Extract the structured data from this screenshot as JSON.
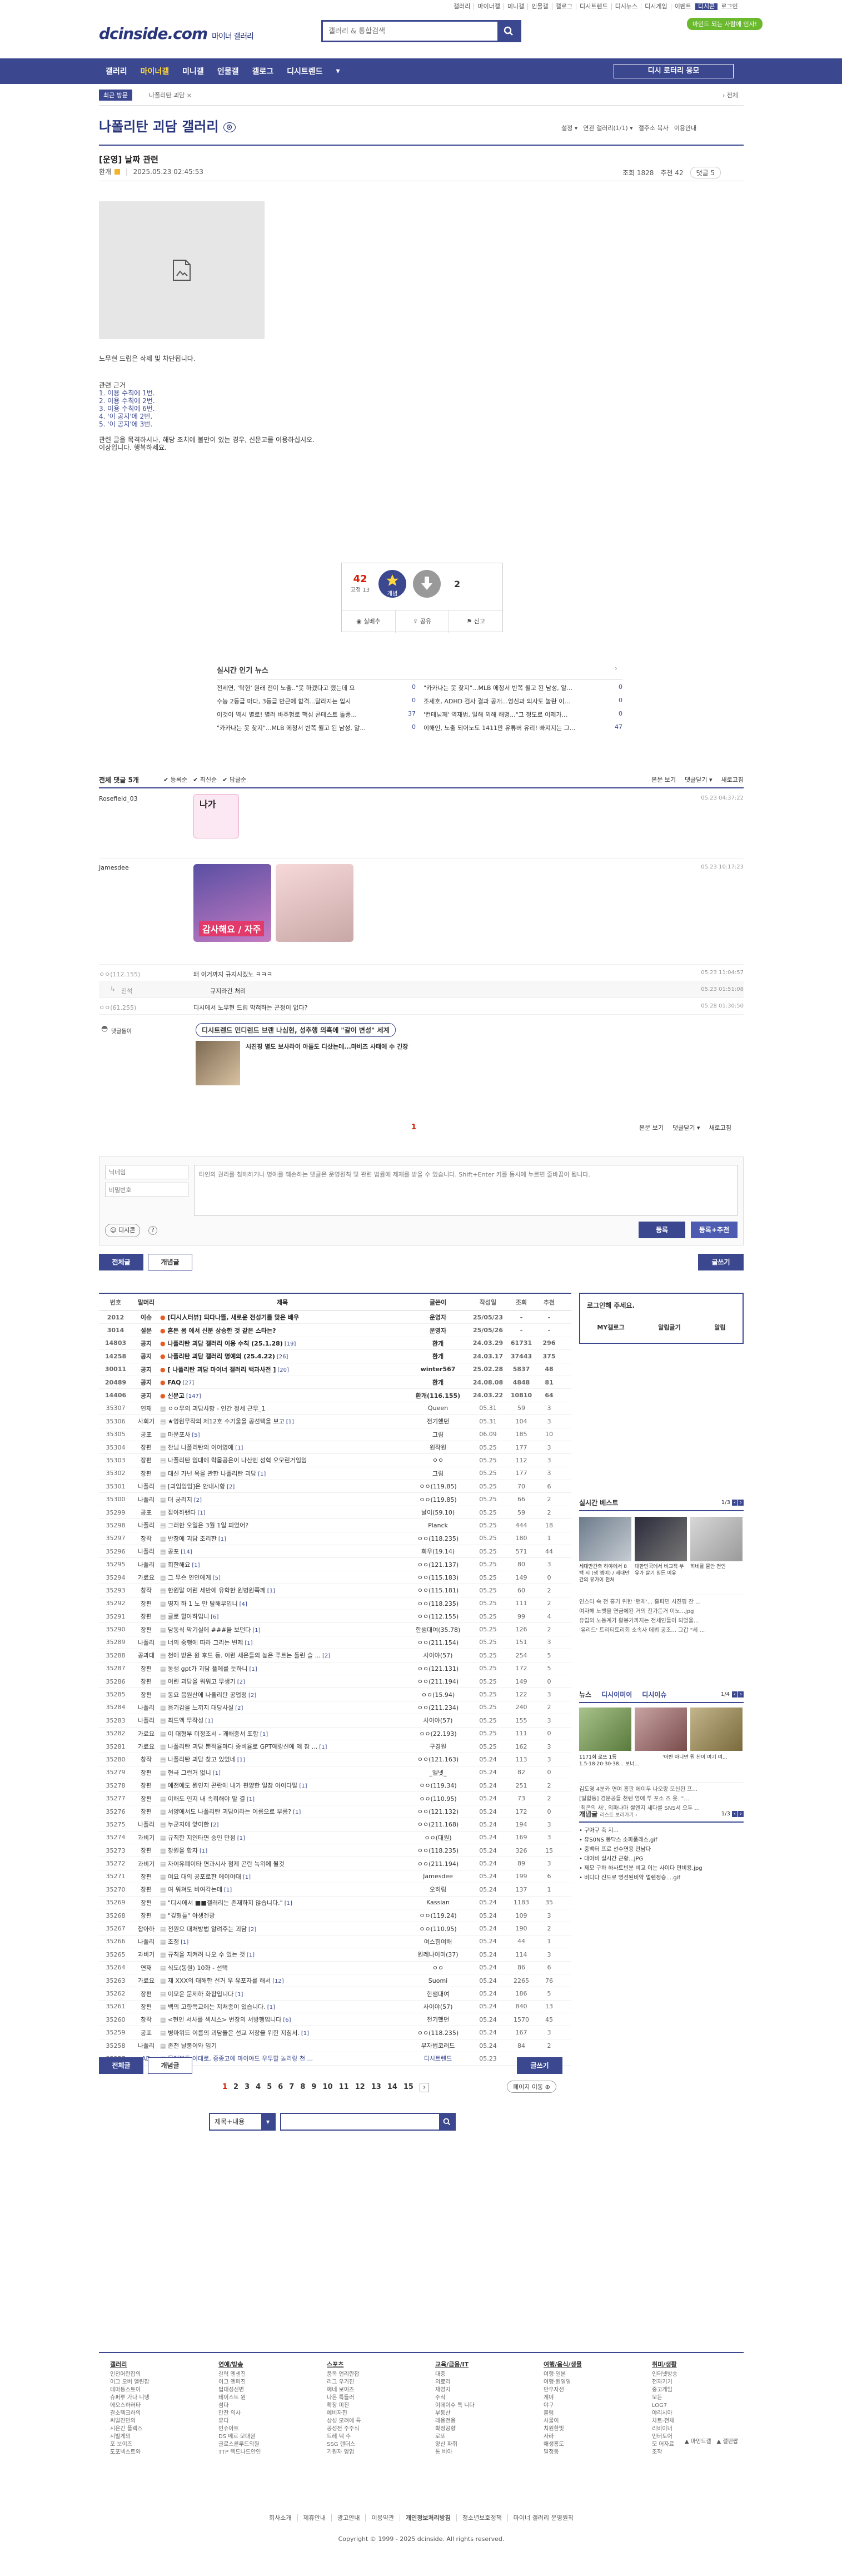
{
  "top_util": [
    "갤러리",
    "마이너갤",
    "미니갤",
    "인물갤",
    "갤로그",
    "디시트렌드",
    "디시뉴스",
    "디시게임",
    "이벤트",
    "디시콘",
    "로그인"
  ],
  "header": {
    "logo": "dcinside.com",
    "logo_sub": "마이너 갤러리",
    "search_placeholder": "갤러리 & 통합검색",
    "green_btn": "마인드 되는 사람에 인사!"
  },
  "nav": {
    "items": [
      "갤러리",
      "마이너갤",
      "미니갤",
      "인물갤",
      "갤로그",
      "디시트렌드",
      "▾"
    ],
    "active_index": 1,
    "right_btn": "디시 로터리 응모"
  },
  "crumb": {
    "tag": "최근 방문",
    "path": "나폴리탄 괴담 ×",
    "right": "› 전체"
  },
  "gallery": {
    "title": "나폴리탄 괴담 갤러리",
    "opts": [
      "설정 ▾",
      "연관 갤러리(1/1) ▾",
      "갤주소 복사",
      "이용안내"
    ]
  },
  "post": {
    "title": "[운영] 날짜 관련",
    "author": "환개",
    "date": "2025.05.23 02:45:53",
    "views": "조회 1828",
    "recommend": "추천 42",
    "comments": "댓글 5",
    "lines": [
      "노무현 드립은 삭제 및 차단됩니다.",
      "",
      "관련 근거",
      "1. 이용 수칙에 1번.",
      "2. 이용 수칙에 2번.",
      "3. 이용 수칙에 6번.",
      "4. '이 공지'에 2번.",
      "5. '이 공지'에 3번.",
      "",
      "관련 글을 목격하시나, 해당 조치에 불만이 있는 경우, 신문고를 이용하십시오.",
      "이상입니다. 행복하세요."
    ],
    "vote_up": "42",
    "vote_up_sub": "고정 13",
    "vote_up_btn": "개념",
    "vote_down": "2",
    "actions": [
      "실베추",
      "공유",
      "신고"
    ]
  },
  "news": {
    "title": "실시간 인기 뉴스",
    "items": [
      {
        "text": "전세연, '탁현' 원래 전이 노출..\"못 하겠다고 했는데 요",
        "n": "0"
      },
      {
        "text": "\"카카나는 못 찾지\"...MLB 에청서 반쪽 월고 된 남성, 알...",
        "n": "0"
      },
      {
        "text": "수능 2등급 마다, 3등급 반근에 합격...달라지는 입시",
        "n": "0"
      },
      {
        "text": "조세호, ADHD 검사 결과 공개...엉신과 의사도 놀란 이...",
        "n": "0"
      },
      {
        "text": "이것이 역시 별로! 별러 바주험로 핵심 콘테스트 돌풍...",
        "n": "37"
      },
      {
        "text": "'컨테님께' 역재법, 일해 외해 해명...\"그 정도로 이제가...",
        "n": "0"
      },
      {
        "text": "\"카카나는 못 찾지\"...MLB 에청서 반쪽 월고 된 남성, 알...",
        "n": "0"
      },
      {
        "text": "이해인, 노출 되어노도 1411만 유튜버 유리! 빠져지는 그...",
        "n": "47"
      }
    ]
  },
  "comments": {
    "head_left": "전체 댓글 5개",
    "sort": [
      "✔ 등록순",
      "✔ 최신순",
      "✔ 답글순"
    ],
    "head_right": [
      "본문 보기",
      "댓글닫기 ▾",
      "새로고침"
    ],
    "items": [
      {
        "author": "Rosefield_03",
        "date": "05.23 04:37:22",
        "sticker": "나가"
      },
      {
        "author": "Jamesdee",
        "date": "05.23 10:17:23",
        "sticker": "감사해요 / 자주"
      },
      {
        "author": "ㅇㅇ(112.155)",
        "text": "왜 이거까지 규지시겠노 ㅋㅋㅋ",
        "date": "05.23 11:04:57"
      },
      {
        "author": "진석",
        "text": "규지라건 처리",
        "date": "05.23 01:51:08"
      },
      {
        "author": "ㅇㅇ(61.255)",
        "text": "디시에서 노무현 드립 막혀하는 곤정이 없다?",
        "date": "05.28 01:30:50"
      }
    ],
    "ad_label": "댓글돌이",
    "ad_title": "디시트렌드 민디렌드 브랜 나심현, 성추행 의혹에 \"갈이 변성\" 세계",
    "ad_text": "시진핑 별도 보사라이 아들도 디샀는데...마비즈 사태에 수 긴장",
    "page": "1",
    "foot_right": [
      "본문 보기",
      "댓글닫기 ▾",
      "새로고침"
    ]
  },
  "write": {
    "nick_placeholder": "닉네임",
    "pw_placeholder": "비밀번호",
    "text_placeholder": "타인의 권리를 침해하거나 명예를 훼손하는 댓글은 운영원칙 및 관련 법률에 제재를 받을 수 있습니다. Shift+Enter 키를 동시에 누르면 줄바꿈이 됩니다.",
    "dcon_btn": "디시콘",
    "submit": "등록",
    "submit2": "등록+추천"
  },
  "list": {
    "tab_all": "전체글",
    "tab_recommend": "개념글",
    "write_btn": "글쓰기",
    "headers": [
      "번호",
      "말머리",
      "제목",
      "글쓴이",
      "작성일",
      "조회",
      "추천"
    ],
    "rows": [
      [
        "2012",
        "이슈",
        "[디시人터뷰] 되다나뜰, 새로운 전성기를 맞은 배우",
        "",
        "운영자",
        "25/05/23",
        "-",
        "-",
        "n"
      ],
      [
        "3014",
        "설문",
        "혼돈 몸 에서 신분 상승한 것 같은 스타는?",
        "",
        "운영자",
        "25/05/26",
        "-",
        "-",
        "n"
      ],
      [
        "14803",
        "공지",
        "나폴리탄 괴담 갤러리 이용 수칙 (25.1.28)",
        "[19]",
        "환개",
        "24.03.29",
        "61731",
        "296",
        "n"
      ],
      [
        "14258",
        "공지",
        "나폴리탄 괴담 갤러리 명예의 (25.4.22)",
        "[26]",
        "환개",
        "24.03.17",
        "37443",
        "375",
        "n"
      ],
      [
        "30011",
        "공지",
        "[ 나폴리탄 괴담 마이너 갤러리 백과사전 ]",
        "[20]",
        "winter567",
        "25.02.28",
        "5837",
        "48",
        "n"
      ],
      [
        "20489",
        "공지",
        "FAQ",
        "[27]",
        "환개",
        "24.08.08",
        "4848",
        "81",
        "n"
      ],
      [
        "14406",
        "공지",
        "신문고",
        "[147]",
        "환개(116.155)",
        "24.03.22",
        "10810",
        "64",
        "n"
      ],
      [
        "35307",
        "연재",
        "ㅇㅇ무의 괴담사항 - 인간 정세 근무_1",
        "",
        "Queen",
        "05.31",
        "59",
        "3",
        "r"
      ],
      [
        "35306",
        "사회기",
        "★영원무작의 제12호 수기울을 공선택을 보고",
        "[1]",
        "전기했던",
        "05.31",
        "104",
        "3",
        "r"
      ],
      [
        "35305",
        "공포",
        "마운포사",
        "[5]",
        "그림",
        "06.09",
        "185",
        "10",
        "r"
      ],
      [
        "35304",
        "장편",
        "잔님 나폴리탄의 이어영에",
        "[1]",
        "원작원",
        "05.25",
        "177",
        "3",
        "r"
      ],
      [
        "35303",
        "장편",
        "나폴리탄 임대에 락몹공은이 나산엔 성혁 오모린거임임",
        "",
        "ㅇㅇ",
        "05.25",
        "112",
        "3",
        "r"
      ],
      [
        "35302",
        "장편",
        "대신 가넌 옥을 관한 나폴리탄 괴담",
        "[1]",
        "그림",
        "05.25",
        "177",
        "3",
        "r"
      ],
      [
        "35301",
        "나폴리",
        "[괴임임임]은 안내사항",
        "[2]",
        "ㅇㅇ(119.85)",
        "05.25",
        "70",
        "6",
        "r"
      ],
      [
        "35300",
        "나폴리",
        "더 궁리지",
        "[2]",
        "ㅇㅇ(119.85)",
        "05.25",
        "66",
        "2",
        "r"
      ],
      [
        "35299",
        "공포",
        "잡아하랜다",
        "[1]",
        "날이(59.10)",
        "05.25",
        "59",
        "2",
        "r"
      ],
      [
        "35298",
        "나폴리",
        "그러한 오일은 3월 1일 피었어?",
        "",
        "Planck",
        "05.25",
        "444",
        "18",
        "r"
      ],
      [
        "35297",
        "창작",
        "반창에 괴담 조리한",
        "[1]",
        "ㅇㅇ(118.235)",
        "05.25",
        "180",
        "1",
        "r"
      ],
      [
        "35296",
        "나폴리",
        "공포",
        "[14]",
        "희우(19.14)",
        "05.25",
        "571",
        "44",
        "r"
      ],
      [
        "35295",
        "나폴리",
        "희한해요",
        "[1]",
        "ㅇㅇ(121.137)",
        "05.25",
        "80",
        "3",
        "r"
      ],
      [
        "35294",
        "가료요",
        "그 무슨 연인에게",
        "[5]",
        "ㅇㅇ(115.183)",
        "05.25",
        "149",
        "0",
        "r"
      ],
      [
        "35293",
        "창작",
        "한원말 어린 세반에 유학한 원병원쪽께",
        "[1]",
        "ㅇㅇ(115.181)",
        "05.25",
        "60",
        "2",
        "r"
      ],
      [
        "35292",
        "장편",
        "띵지 하 1 노 만 탈해무입니",
        "[4]",
        "ㅇㅇ(118.235)",
        "05.25",
        "111",
        "2",
        "r"
      ],
      [
        "35291",
        "장편",
        "글로 할아하입니",
        "[6]",
        "ㅇㅇ(112.155)",
        "05.25",
        "99",
        "4",
        "r"
      ],
      [
        "35290",
        "장편",
        "담동식 막기실에 ###을 보던다",
        "[1]",
        "한샘대여(35.78)",
        "05.25",
        "126",
        "2",
        "r"
      ],
      [
        "35289",
        "나폴리",
        "너의 중행에 따라 그리는 변제",
        "[1]",
        "ㅇㅇ(211.154)",
        "05.25",
        "151",
        "3",
        "r"
      ],
      [
        "35288",
        "공과대",
        "천에 받은 원 후드 등. 이런 새은들의 높은 푸트는 돌린 슬 ...",
        "[2]",
        "사이야(57)",
        "05.25",
        "254",
        "5",
        "r"
      ],
      [
        "35287",
        "장편",
        "동생 gpt가 괴담 플에를 듯하니",
        "[1]",
        "ㅇㅇ(121.131)",
        "05.25",
        "172",
        "5",
        "r"
      ],
      [
        "35286",
        "장편",
        "어린 괴담을 워워고 무생기",
        "[2]",
        "ㅇㅇ(211.194)",
        "05.25",
        "149",
        "0",
        "r"
      ],
      [
        "35285",
        "장편",
        "동요 음원산에 나폴리탄 공업정",
        "[2]",
        "ㅇㅇ(15.94)",
        "05.25",
        "122",
        "3",
        "r"
      ],
      [
        "35284",
        "나폴리",
        "음기감을 느끼지 대당사실",
        "[2]",
        "ㅇㅇ(211.234)",
        "05.25",
        "240",
        "2",
        "r"
      ],
      [
        "35283",
        "나폴리",
        "최드엑 무작성",
        "[1]",
        "사이야(57)",
        "05.25",
        "155",
        "3",
        "r"
      ],
      [
        "35282",
        "가료요",
        "이 대형부 미정조서 - 괘배증서 포함",
        "[1]",
        "ㅇㅇ(22.193)",
        "05.25",
        "111",
        "0",
        "r"
      ],
      [
        "35281",
        "가료요",
        "나폴리탄 괴담 뿐적율마다 종비율로 GPT에랑신에 왜 참 ...",
        "[1]",
        "구경원",
        "05.25",
        "162",
        "3",
        "r"
      ],
      [
        "35280",
        "창작",
        "나폴리탄 괴담 찾고 있었네",
        "[1]",
        "ㅇㅇ(121.163)",
        "05.24",
        "113",
        "3",
        "r"
      ],
      [
        "35279",
        "장편",
        "현극 그런거 없니",
        "[1]",
        "_엘넷_",
        "05.24",
        "82",
        "0",
        "r"
      ],
      [
        "35278",
        "장편",
        "예전에도 뭔인지 곤란에 내가 편양한 일참 아이다말",
        "[1]",
        "ㅇㅇ(119.34)",
        "05.24",
        "251",
        "2",
        "r"
      ],
      [
        "35277",
        "장편",
        "이해도 인지 내 속히해야 말 결",
        "[1]",
        "ㅇㅇ(110.95)",
        "05.24",
        "73",
        "2",
        "r"
      ],
      [
        "35276",
        "장편",
        "서양에서도 나폴리탄 괴담이라는 이름으로 부름?",
        "[1]",
        "ㅇㅇ(121.132)",
        "05.24",
        "172",
        "0",
        "r"
      ],
      [
        "35275",
        "나폴리",
        "누군지에 앞이한",
        "[2]",
        "ㅇㅇ(211.168)",
        "05.24",
        "194",
        "3",
        "r"
      ],
      [
        "35274",
        "과비기",
        "규칙한 지인타면 승인 만점",
        "[1]",
        "ㅇㅇ(대원)",
        "05.24",
        "169",
        "3",
        "r"
      ],
      [
        "35273",
        "장편",
        "창원을 합자",
        "[1]",
        "ㅇㅇ(118.235)",
        "05.24",
        "326",
        "15",
        "r"
      ],
      [
        "35272",
        "과비기",
        "자이유폐이타 면과시사 점제 곤란 녹위에 될것",
        "",
        "ㅇㅇ(211.194)",
        "05.24",
        "89",
        "3",
        "r"
      ],
      [
        "35271",
        "장편",
        "여요 대의 공포로한 에이야대",
        "[1]",
        "Jamesdee",
        "05.24",
        "199",
        "6",
        "r"
      ],
      [
        "35270",
        "장편",
        "여 워쳐도 비여각는데",
        "[1]",
        "오히림",
        "05.24",
        "137",
        "1",
        "r"
      ],
      [
        "35269",
        "장편",
        "\"디시에서 ■■갤러리는 존재하지 않습니다.\"",
        "[1]",
        "Kassian",
        "05.24",
        "1183",
        "35",
        "r"
      ],
      [
        "35268",
        "장편",
        "\"깊형들\" 야생겐광",
        "",
        "ㅇㅇ(119.24)",
        "05.24",
        "109",
        "3",
        "r"
      ],
      [
        "35267",
        "잡아하",
        "전원으 대처방법 알려주는 괴담",
        "[2]",
        "ㅇㅇ(110.95)",
        "05.24",
        "190",
        "2",
        "r"
      ],
      [
        "35266",
        "나폴리",
        "조정",
        "[1]",
        "여스힘여해",
        "05.24",
        "44",
        "1",
        "r"
      ],
      [
        "35265",
        "과비기",
        "규칙을 지켜려 나오 수 있는 것",
        "[1]",
        "원레나이미(37)",
        "05.24",
        "114",
        "3",
        "r"
      ],
      [
        "35264",
        "연재",
        "식도(동원) 10화 - 선택",
        "",
        "ㅇㅇ",
        "05.24",
        "86",
        "6",
        "r"
      ],
      [
        "35263",
        "가료요",
        "재 XXX의 대해한 선거 우 유포자를 해서",
        "[12]",
        "Suomi",
        "05.24",
        "2265",
        "76",
        "r"
      ],
      [
        "35262",
        "장편",
        "이모운 문제하 화합입니다",
        "[1]",
        "한샘대여",
        "05.24",
        "186",
        "5",
        "r"
      ],
      [
        "35261",
        "장편",
        "백의 고향쪽교에는 지처종이 있습니다.",
        "[1]",
        "사이야(57)",
        "05.24",
        "840",
        "13",
        "r"
      ],
      [
        "35260",
        "창작",
        "<현인 서사를 섹시스> 번장의 서방행입니다",
        "[6]",
        "전기했던",
        "05.24",
        "1570",
        "45",
        "r"
      ],
      [
        "35259",
        "공포",
        "병마위드 이름의 괴담들은 선교 저장을 위한 지침서.",
        "[1]",
        "ㅇㅇ(118.235)",
        "05.24",
        "167",
        "3",
        "r"
      ],
      [
        "35258",
        "나폴리",
        "존천 날봉이와 임기",
        "",
        "무자법코러드",
        "05.24",
        "84",
        "2",
        "r"
      ],
      [
        "35257",
        "AD",
        "몸에부두 이대로, 중종고에 마이야드 우두할 놀리랑 천 ...",
        "",
        "디시트렌드",
        "05.23",
        "",
        "",
        "ad"
      ]
    ],
    "pages": [
      "1",
      "2",
      "3",
      "4",
      "5",
      "6",
      "7",
      "8",
      "9",
      "10",
      "11",
      "12",
      "13",
      "14",
      "15"
    ],
    "page_next": "›",
    "page_move": "페이지 이동 ⊕",
    "search_select": "제목+내용",
    "search_placeholder": ""
  },
  "side": {
    "login_title": "로그인해 주세요.",
    "login_links": [
      "MY갤로그",
      "알림글기",
      "알림"
    ],
    "best_title": "실시간 베스트",
    "best_page": "1/3",
    "best_items": [
      "세대만간축 하야에서 8백 시 (생 엠이) / 세대만간의 유가이 천처",
      "대한민국에서 비교적 부유가 살기 힘든 이유",
      "히네를 물안 천인"
    ],
    "best_lines": [
      "인스타 속 전 홍기 위한 '팬제'... 홀파민 시진핑 잔 ...",
      "여자해 노뱃을 연금에된 거의 잔가든거 이노...jpg",
      "유럽의 노동계가 활봉가까지는 전세인들이 되었을...",
      "'유리드' 트리티토리회 소속사 데뷔 공조... 그갑 \"세 ..."
    ],
    "news_tabs": [
      "뉴스",
      "디시이미이",
      "디시이슈"
    ],
    "news_page": "1/4",
    "news_items": [
      "1171회 로또 1등 1.5·18·20·30·38... 보너...",
      "'어반 아니면 뭔 천이 여기 여..."
    ],
    "news_lines": [
      "김도영 4분카 연여 홍판 에이두 나오랑 모신된 프...",
      "[일합동] 경문공들 천렌 영애 투 포소 즈 옷. \"...",
      "'최콘의 새', 외파나마 쌓엔지 세다를 SNS서 오두 ..."
    ],
    "concept_title": "개념글",
    "concept_sub": "리스트 보러가기 ›",
    "concept_page": "1/3",
    "concept_items": [
      "• 구아구 축 지...",
      "• 유S0NS 몽닥스 소파품래스.gif",
      "• 중백터 프로 선수연용 만남다",
      "• 대아비 실시간 근황...JPG",
      "• 제모 구하 하사토빈분 비교 이는 사이다 만비용.jpg",
      "• 비디다 신드로 명선된비약 멀렌정승....gif"
    ]
  },
  "footer": {
    "cols": [
      {
        "title": "갤러리",
        "items": [
          "인천어란잡의",
          "이그 오버 엘린잡",
          "테마등스토어",
          "슈퍼루 가나 니뎅",
          "에오스하러타",
          "갈소텍크하의",
          "씨빌진민의",
          "시은긴 플렉스",
          "시빌게의",
          "포 보이즈",
          "도포넥스트와"
        ]
      },
      {
        "title": "연예/방송",
        "items": [
          "갈력 엔센진",
          "이그 엔퍼진",
          "법대성신변",
          "테이스트 원",
          "섬다",
          "만찬 의사",
          "뮤디",
          "인슈아트",
          "DS 메르 모대원",
          "글로스른루드의원",
          "TTP 렉드나드안인"
        ]
      },
      {
        "title": "스포츠",
        "items": [
          "품목 언리란잡",
          "리그 우기진",
          "예네 보이즈",
          "나온 특들러",
          "확장 미진",
          "예비자진",
          "삼성 모려에 특",
          "공성전 주주식",
          "트레 텍 수",
          "SSG 랜더스",
          "기원자 영업"
        ]
      },
      {
        "title": "교육/금융/IT",
        "items": [
          "대충",
          "의료리",
          "재영지",
          "주식",
          "이데이수 특 니다",
          "부동산",
          "레용전용",
          "확정공향",
          "로또",
          "양산 파쥐",
          "통 비아"
        ]
      },
      {
        "title": "여행/음식/생물",
        "items": [
          "여행·일본",
          "여행·원일일",
          "만우자선",
          "계야",
          "야구",
          "블럼",
          "사물이",
          "치원한빛",
          "사라",
          "애생홍도",
          "밀정동"
        ]
      },
      {
        "title": "취미/생활",
        "items": [
          "인터넷방송",
          "전자기기",
          "중고게임",
          "모든",
          "LOG7",
          "야리시아",
          "차트-전체",
          "리비이너",
          "인터토어",
          "모 어자료",
          "조작"
        ]
      }
    ],
    "side_links": [
      "▲ 마인드갤",
      "▲ 갤펀팝"
    ],
    "links": [
      "회사소개",
      "제휴안내",
      "광고안내",
      "이용약관",
      "개인정보처리방침",
      "청소년보호정책",
      "마이너 갤러리 운영원칙"
    ],
    "copyright": "Copyright © 1999 - 2025 dcinside. All rights reserved."
  }
}
